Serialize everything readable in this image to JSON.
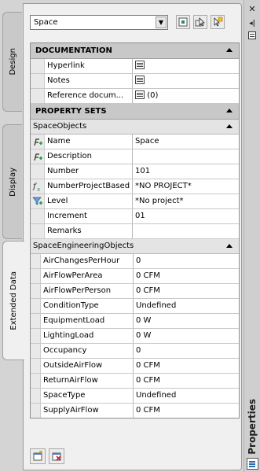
{
  "tabs": [
    {
      "label": "Design",
      "active": false
    },
    {
      "label": "Display",
      "active": false
    },
    {
      "label": "Extended Data",
      "active": true
    }
  ],
  "titlebar": {
    "title": "Properties",
    "close_icon": "close-icon",
    "autohide_icon": "autohide-icon",
    "menu_icon": "menu-icon"
  },
  "toolbar": {
    "selected_value": "Space"
  },
  "documentation": {
    "title": "DOCUMENTATION",
    "rows": [
      {
        "name": "Hyperlink",
        "value": ""
      },
      {
        "name": "Notes",
        "value": ""
      },
      {
        "name": "Reference docum...",
        "value": "(0)"
      }
    ]
  },
  "property_sets": {
    "title": "PROPERTY SETS",
    "space_objects": {
      "title": "SpaceObjects",
      "rows": [
        {
          "icon": "edit-formula-icon",
          "name": "Name",
          "value": "Space"
        },
        {
          "icon": "edit-formula-icon",
          "name": "Description",
          "value": ""
        },
        {
          "icon": "",
          "name": "Number",
          "value": "101"
        },
        {
          "icon": "function-icon",
          "name": "NumberProjectBased",
          "value": "*NO PROJECT*"
        },
        {
          "icon": "filter-icon",
          "name": "Level",
          "value": "*No project*"
        },
        {
          "icon": "",
          "name": "Increment",
          "value": "01"
        },
        {
          "icon": "",
          "name": "Remarks",
          "value": ""
        }
      ]
    },
    "space_engineering": {
      "title": "SpaceEngineeringObjects",
      "rows": [
        {
          "name": "AirChangesPerHour",
          "value": "0"
        },
        {
          "name": "AirFlowPerArea",
          "value": "0 CFM"
        },
        {
          "name": "AirFlowPerPerson",
          "value": "0 CFM"
        },
        {
          "name": "ConditionType",
          "value": "Undefined"
        },
        {
          "name": "EquipmentLoad",
          "value": "0 W"
        },
        {
          "name": "LightingLoad",
          "value": "0 W"
        },
        {
          "name": "Occupancy",
          "value": "0"
        },
        {
          "name": "OutsideAirFlow",
          "value": "0 CFM"
        },
        {
          "name": "ReturnAirFlow",
          "value": "0 CFM"
        },
        {
          "name": "SpaceType",
          "value": "Undefined"
        },
        {
          "name": "SupplyAirFlow",
          "value": "0 CFM"
        }
      ]
    }
  }
}
